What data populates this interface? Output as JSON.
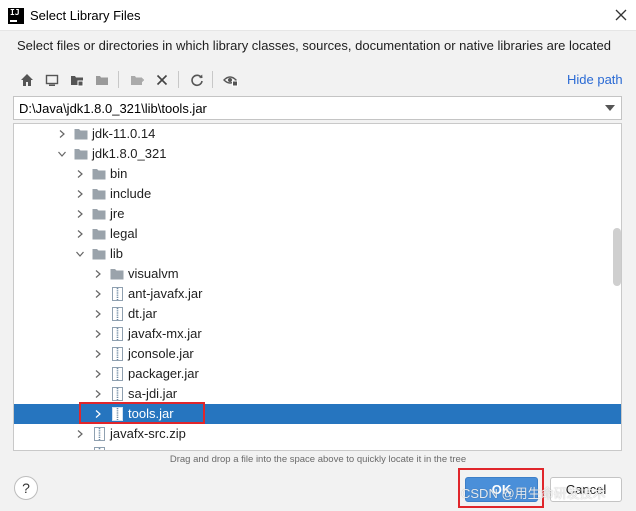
{
  "window": {
    "app_icon_text": "IJ",
    "title": "Select Library Files"
  },
  "description": "Select files or directories in which library classes, sources, documentation or native libraries are located",
  "toolbar": {
    "buttons": [
      "home-icon",
      "desktop-icon",
      "project-folder-icon",
      "module-folder-icon",
      "new-folder-icon",
      "delete-icon",
      "refresh-icon",
      "show-hidden-icon"
    ],
    "hide_path_label": "Hide path"
  },
  "path": {
    "value": "D:\\Java\\jdk1.8.0_321\\lib\\tools.jar"
  },
  "tree": {
    "items": [
      {
        "label": "jdk-11.0.14",
        "kind": "folder",
        "expanded": false
      },
      {
        "label": "jdk1.8.0_321",
        "kind": "folder",
        "expanded": true
      },
      {
        "label": "bin",
        "kind": "folder",
        "expanded": false
      },
      {
        "label": "include",
        "kind": "folder",
        "expanded": false
      },
      {
        "label": "jre",
        "kind": "folder",
        "expanded": false
      },
      {
        "label": "legal",
        "kind": "folder",
        "expanded": false
      },
      {
        "label": "lib",
        "kind": "folder",
        "expanded": true
      },
      {
        "label": "visualvm",
        "kind": "folder",
        "expanded": false
      },
      {
        "label": "ant-javafx.jar",
        "kind": "jar",
        "expanded": false
      },
      {
        "label": "dt.jar",
        "kind": "jar",
        "expanded": false
      },
      {
        "label": "javafx-mx.jar",
        "kind": "jar",
        "expanded": false
      },
      {
        "label": "jconsole.jar",
        "kind": "jar",
        "expanded": false
      },
      {
        "label": "packager.jar",
        "kind": "jar",
        "expanded": false
      },
      {
        "label": "sa-jdi.jar",
        "kind": "jar",
        "expanded": false
      },
      {
        "label": "tools.jar",
        "kind": "jar",
        "expanded": false,
        "selected": true
      },
      {
        "label": "javafx-src.zip",
        "kind": "zip",
        "expanded": false
      }
    ]
  },
  "hint": "Drag and drop a file into the space above to quickly locate it in the tree",
  "buttons": {
    "help": "?",
    "ok": "OK",
    "cancel": "Cancel"
  },
  "watermark": "CSDN @用生命研发技术",
  "colors": {
    "selection": "#2675bf",
    "link": "#2a6ad4",
    "highlight": "#e0262b",
    "ok_button": "#4a8fd9"
  }
}
